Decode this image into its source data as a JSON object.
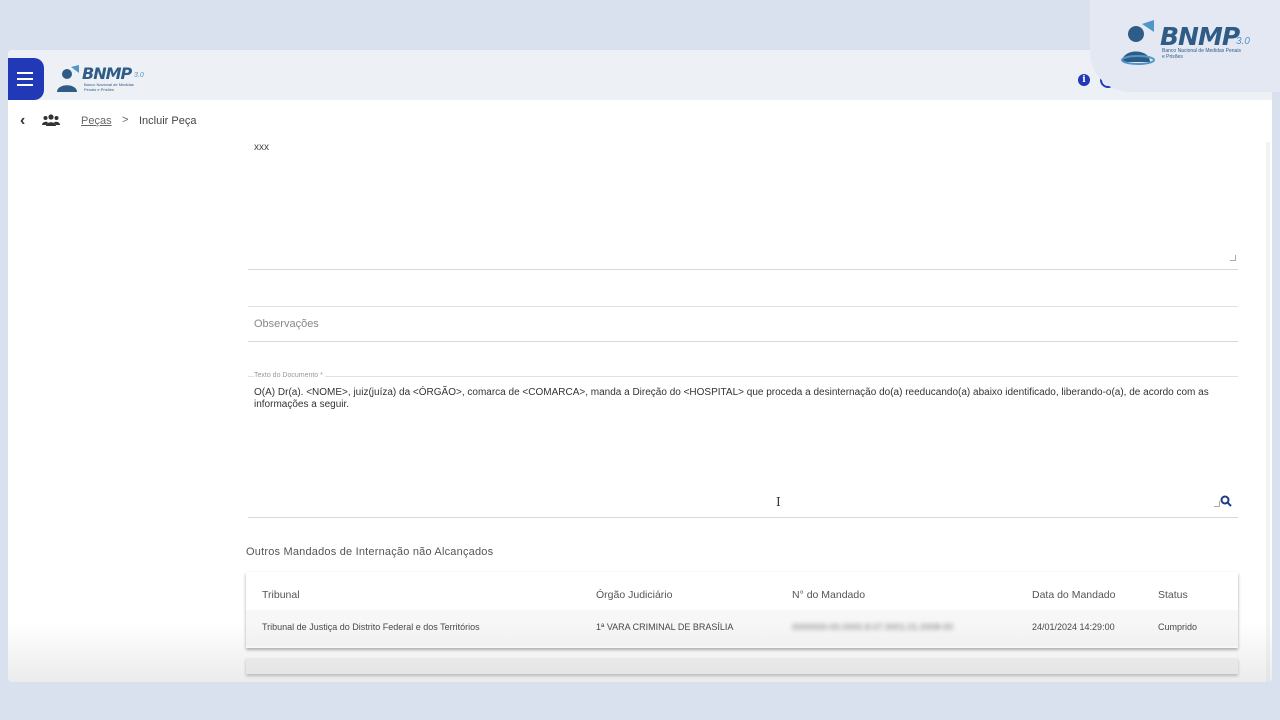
{
  "app": {
    "brand": "BNMP",
    "version": "3.0",
    "tagline": "Banco Nacional de Medidas Penais e Prisões"
  },
  "topbar": {
    "icons": [
      "menu-icon",
      "info-icon",
      "accessibility-icon",
      "search-icon"
    ]
  },
  "breadcrumb": {
    "link": "Peças",
    "separator": ">",
    "current": "Incluir Peça"
  },
  "form": {
    "top_textarea_value": "xxx",
    "observacoes_placeholder": "Observações",
    "documento_label": "Texto do Documento *",
    "documento_text": "O(A) Dr(a). <NOME>, juiz(juíza) da <ÓRGÃO>, comarca de <COMARCA>, manda a Direção do <HOSPITAL> que proceda a desinternação do(a) reeducando(a) abaixo identificado, liberando-o(a), de acordo com as informações a seguir."
  },
  "section": {
    "title": "Outros Mandados de Internação não Alcançados"
  },
  "table": {
    "headers": [
      "Tribunal",
      "Órgão Judiciário",
      "N° do Mandado",
      "Data do Mandado",
      "Status"
    ],
    "rows": [
      {
        "tribunal": "Tribunal de Justiça do Distrito Federal e dos Territórios",
        "orgao": "1ª VARA CRIMINAL DE BRASÍLIA",
        "mandado": "0000000-00.0000.8.07.0001.01.0008-00",
        "data": "24/01/2024 14:29:00",
        "status": "Cumprido"
      }
    ]
  },
  "colors": {
    "primary": "#2139b6",
    "brand": "#2f5c86",
    "background": "#d9e0ee"
  }
}
